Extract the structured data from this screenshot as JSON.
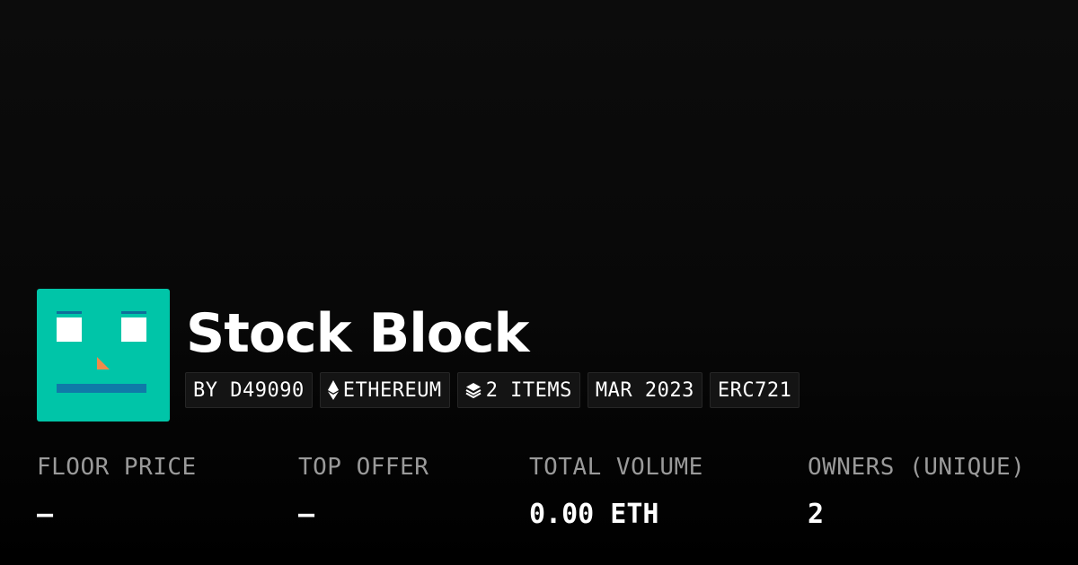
{
  "collection": {
    "name": "Stock Block",
    "avatar_colors": {
      "background": "#00c5a8",
      "eyes": "#ffffff",
      "brows": "#0f6f9a",
      "nose": "#f08a4b",
      "mouth": "#0f7aa8"
    }
  },
  "badges": {
    "creator": "BY D49090",
    "chain": "ETHEREUM",
    "chain_icon": "ethereum-icon",
    "items": "2 ITEMS",
    "items_icon": "layers-icon",
    "date": "MAR 2023",
    "standard": "ERC721"
  },
  "stats": {
    "floor_price": {
      "label": "FLOOR PRICE",
      "value": "–"
    },
    "top_offer": {
      "label": "TOP OFFER",
      "value": "–"
    },
    "total_volume": {
      "label": "TOTAL VOLUME",
      "value": "0.00 ETH"
    },
    "owners": {
      "label": "OWNERS (UNIQUE)",
      "value": "2"
    }
  }
}
